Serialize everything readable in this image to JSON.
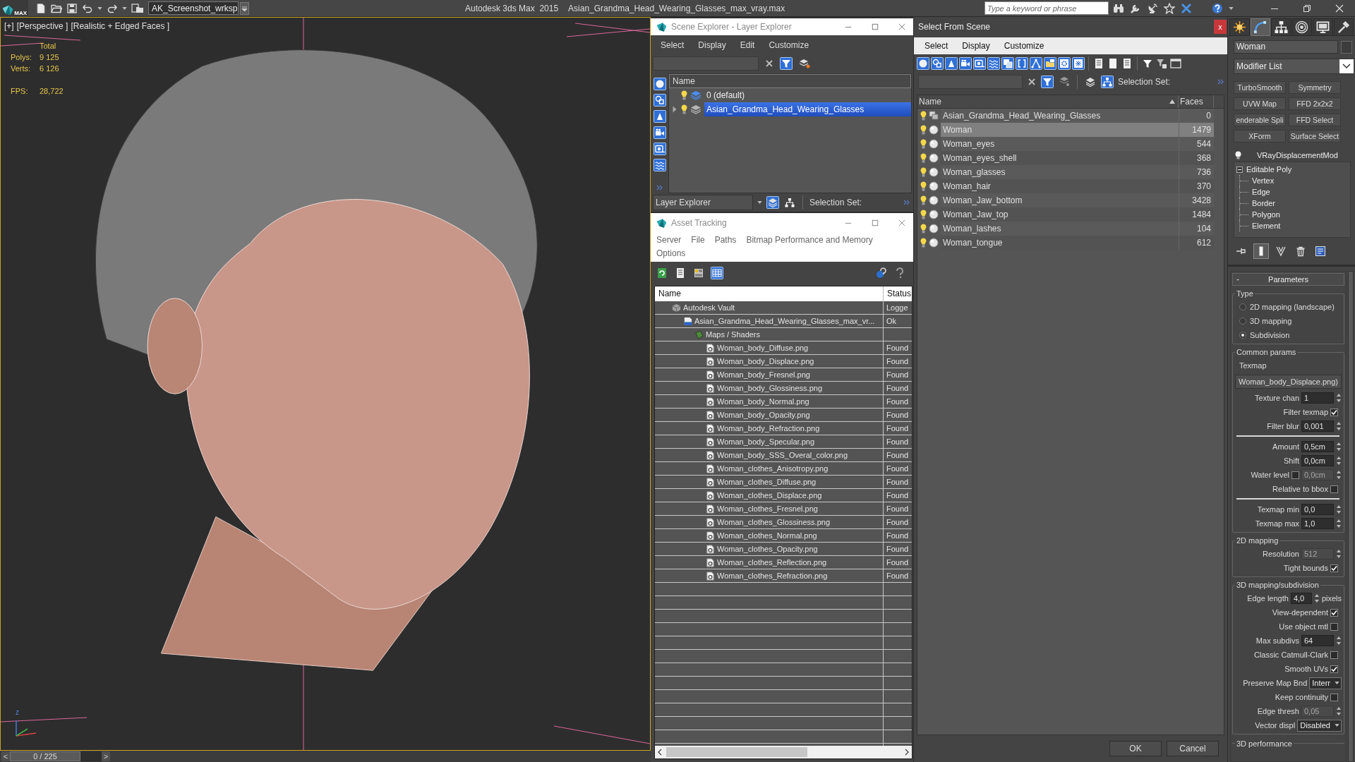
{
  "title_bar": {
    "logo_text": "MAX",
    "workspace": "AK_Screenshot_wrksp",
    "app_title": "Autodesk 3ds Max  2015",
    "file_title": "Asian_Grandma_Head_Wearing_Glasses_max_vray.max",
    "search": {
      "placeholder": "Type a keyword or phrase"
    }
  },
  "viewport": {
    "labels": [
      "[+]",
      "[Perspective ]",
      "[Realistic + Edged Faces ]"
    ],
    "stats_title": "Total",
    "stats": [
      {
        "label": "Polys:",
        "value": "9 125"
      },
      {
        "label": "Verts:",
        "value": "6 126"
      }
    ],
    "fps": {
      "label": "FPS:",
      "value": "28,722"
    },
    "axis_label": "z"
  },
  "time_slider": {
    "previous": "<",
    "frame": "0 / 225",
    "level": 0,
    "next": ">"
  },
  "scene_explorer": {
    "title": "Scene Explorer - Layer Explorer",
    "menu": [
      "Select",
      "Display",
      "Edit",
      "Customize"
    ],
    "column": "Name",
    "layers": [
      {
        "name": "0 (default)",
        "active": true,
        "expandable": false,
        "selected": false
      },
      {
        "name": "Asian_Grandma_Head_Wearing_Glasses",
        "active": false,
        "expandable": true,
        "selected": true
      }
    ],
    "explorer": "Layer Explorer",
    "selection_set": "Selection Set:"
  },
  "asset_tracking": {
    "title": "Asset Tracking",
    "menu": [
      "Server",
      "File",
      "Paths",
      "Bitmap Performance and Memory",
      "Options"
    ],
    "columns": [
      "Name",
      "Status"
    ],
    "rows": [
      {
        "kind": "vault",
        "name": "Autodesk Vault",
        "status": "Logge",
        "children": [
          {
            "kind": "max_file",
            "name": "Asian_Grandma_Head_Wearing_Glasses_max_vr...",
            "status": "Ok",
            "children": [
              {
                "kind": "folder",
                "name": "Maps / Shaders",
                "children": [
                  {
                    "kind": "bitmap",
                    "name": "Woman_body_Diffuse.png",
                    "status": "Found"
                  },
                  {
                    "kind": "bitmap",
                    "name": "Woman_body_Displace.png",
                    "status": "Found"
                  },
                  {
                    "kind": "bitmap",
                    "name": "Woman_body_Fresnel.png",
                    "status": "Found"
                  },
                  {
                    "kind": "bitmap",
                    "name": "Woman_body_Glossiness.png",
                    "status": "Found"
                  },
                  {
                    "kind": "bitmap",
                    "name": "Woman_body_Normal.png",
                    "status": "Found"
                  },
                  {
                    "kind": "bitmap",
                    "name": "Woman_body_Opacity.png",
                    "status": "Found"
                  },
                  {
                    "kind": "bitmap",
                    "name": "Woman_body_Refraction.png",
                    "status": "Found"
                  },
                  {
                    "kind": "bitmap",
                    "name": "Woman_body_Specular.png",
                    "status": "Found"
                  },
                  {
                    "kind": "bitmap",
                    "name": "Woman_body_SSS_Overal_color.png",
                    "status": "Found"
                  },
                  {
                    "kind": "bitmap",
                    "name": "Woman_clothes_Anisotropy.png",
                    "status": "Found"
                  },
                  {
                    "kind": "bitmap",
                    "name": "Woman_clothes_Diffuse.png",
                    "status": "Found"
                  },
                  {
                    "kind": "bitmap",
                    "name": "Woman_clothes_Displace.png",
                    "status": "Found"
                  },
                  {
                    "kind": "bitmap",
                    "name": "Woman_clothes_Fresnel.png",
                    "status": "Found"
                  },
                  {
                    "kind": "bitmap",
                    "name": "Woman_clothes_Glossiness.png",
                    "status": "Found"
                  },
                  {
                    "kind": "bitmap",
                    "name": "Woman_clothes_Normal.png",
                    "status": "Found"
                  },
                  {
                    "kind": "bitmap",
                    "name": "Woman_clothes_Opacity.png",
                    "status": "Found"
                  },
                  {
                    "kind": "bitmap",
                    "name": "Woman_clothes_Reflection.png",
                    "status": "Found"
                  },
                  {
                    "kind": "bitmap",
                    "name": "Woman_clothes_Refraction.png",
                    "status": "Found"
                  }
                ]
              }
            ]
          }
        ]
      }
    ]
  },
  "select_from_scene": {
    "title": "Select From Scene",
    "close": "x",
    "menu": [
      "Select",
      "Display",
      "Customize"
    ],
    "selection_set": "Selection Set:",
    "columns": [
      "Name",
      "Faces"
    ],
    "rows": [
      {
        "kind": "group",
        "name": "Asian_Grandma_Head_Wearing_Glasses",
        "faces": "0",
        "selected": false
      },
      {
        "kind": "object",
        "name": "Woman",
        "faces": "1479",
        "selected": true
      },
      {
        "kind": "object",
        "name": "Woman_eyes",
        "faces": "544",
        "selected": false
      },
      {
        "kind": "object",
        "name": "Woman_eyes_shell",
        "faces": "368",
        "selected": false
      },
      {
        "kind": "object",
        "name": "Woman_glasses",
        "faces": "736",
        "selected": false
      },
      {
        "kind": "object",
        "name": "Woman_hair",
        "faces": "370",
        "selected": false
      },
      {
        "kind": "object",
        "name": "Woman_Jaw_bottom",
        "faces": "3428",
        "selected": false
      },
      {
        "kind": "object",
        "name": "Woman_Jaw_top",
        "faces": "1484",
        "selected": false
      },
      {
        "kind": "object",
        "name": "Woman_lashes",
        "faces": "104",
        "selected": false
      },
      {
        "kind": "object",
        "name": "Woman_tongue",
        "faces": "612",
        "selected": false
      }
    ],
    "buttons": [
      "OK",
      "Cancel"
    ]
  },
  "command_panel": {
    "tabs": [
      {
        "kind": "create",
        "selected": false
      },
      {
        "kind": "modify",
        "selected": true
      },
      {
        "kind": "hierarchy",
        "selected": false
      },
      {
        "kind": "motion",
        "selected": false
      },
      {
        "kind": "display",
        "selected": false
      },
      {
        "kind": "utilities",
        "selected": false
      }
    ],
    "object_name": "Woman",
    "modifier_list": "Modifier List",
    "modifier_buttons": [
      "TurboSmooth",
      "Symmetry",
      "UVW Map",
      "FFD 2x2x2",
      "enderable Spli",
      "FFD Select",
      "XForm",
      "Surface Select"
    ],
    "stack": [
      {
        "kind": "modifier",
        "name": "VRayDisplacementMod",
        "on": true
      },
      {
        "kind": "base_object",
        "name": "Editable Poly",
        "expanded": true,
        "children": [
          {
            "name": "Vertex"
          },
          {
            "name": "Edge"
          },
          {
            "name": "Border"
          },
          {
            "name": "Polygon"
          },
          {
            "name": "Element"
          }
        ]
      }
    ],
    "stack_tools": [
      {
        "kind": "pin",
        "selected": false
      },
      {
        "kind": "end_result",
        "selected": true
      },
      {
        "kind": "make_unique",
        "selected": false
      },
      {
        "kind": "remove",
        "selected": false
      },
      {
        "kind": "configure",
        "selected": false
      }
    ],
    "rollout": {
      "toggle": "-",
      "title": "Parameters",
      "groups": [
        {
          "title": "Type",
          "rows": [
            {
              "kind": "radio",
              "label": "2D mapping (landscape)",
              "selected": false
            },
            {
              "kind": "radio",
              "label": "3D mapping",
              "selected": false
            },
            {
              "kind": "radio",
              "label": "Subdivision",
              "selected": true
            }
          ]
        },
        {
          "title": "Common params",
          "rows": [
            {
              "kind": "text",
              "label": "Texmap"
            },
            {
              "kind": "map_button",
              "label": "Woman_body_Displace.png)"
            },
            {
              "kind": "spinner",
              "label": "Texture chan",
              "value": "1",
              "disabled": false
            },
            {
              "kind": "check",
              "label": "Filter texmap",
              "checked": true
            },
            {
              "kind": "spinner",
              "label": "Filter blur",
              "value": "0,001",
              "disabled": false
            },
            {
              "kind": "rule"
            },
            {
              "kind": "spinner",
              "label": "Amount",
              "value": "0,5cm",
              "disabled": false
            },
            {
              "kind": "spinner",
              "label": "Shift",
              "value": "0,0cm",
              "disabled": false
            },
            {
              "kind": "check_spinner",
              "label": "Water level",
              "checked": false,
              "value": "0,0cm",
              "disabled": true
            },
            {
              "kind": "check",
              "label": "Relative to bbox",
              "checked": false
            },
            {
              "kind": "rule"
            },
            {
              "kind": "spinner",
              "label": "Texmap min",
              "value": "0,0",
              "disabled": false
            },
            {
              "kind": "spinner",
              "label": "Texmap max",
              "value": "1,0",
              "disabled": false
            }
          ]
        },
        {
          "title": "2D mapping",
          "rows": [
            {
              "kind": "spinner",
              "label": "Resolution",
              "value": "512",
              "disabled": true
            },
            {
              "kind": "check",
              "label": "Tight bounds",
              "checked": true
            }
          ]
        },
        {
          "title": "3D mapping/subdivision",
          "rows": [
            {
              "kind": "spinner",
              "label": "Edge length",
              "value": "4,0",
              "unit": "pixels",
              "disabled": false
            },
            {
              "kind": "check",
              "label": "View-dependent",
              "checked": true
            },
            {
              "kind": "check",
              "label": "Use object mtl",
              "checked": false
            },
            {
              "kind": "spinner",
              "label": "Max subdivs",
              "value": "64",
              "disabled": false
            },
            {
              "kind": "check",
              "label": "Classic Catmull-Clark",
              "checked": false
            },
            {
              "kind": "check",
              "label": "Smooth UVs",
              "checked": true
            },
            {
              "kind": "dropdown",
              "label": "Preserve Map Bnd",
              "value": "Interr"
            },
            {
              "kind": "check",
              "label": "Keep continuity",
              "checked": false
            },
            {
              "kind": "spinner",
              "label": "Edge thresh",
              "value": "0,05",
              "disabled": true
            },
            {
              "kind": "dropdown",
              "label": "Vector displ",
              "value": "Disabled"
            }
          ]
        }
      ]
    },
    "next_rollout": "3D performance"
  }
}
